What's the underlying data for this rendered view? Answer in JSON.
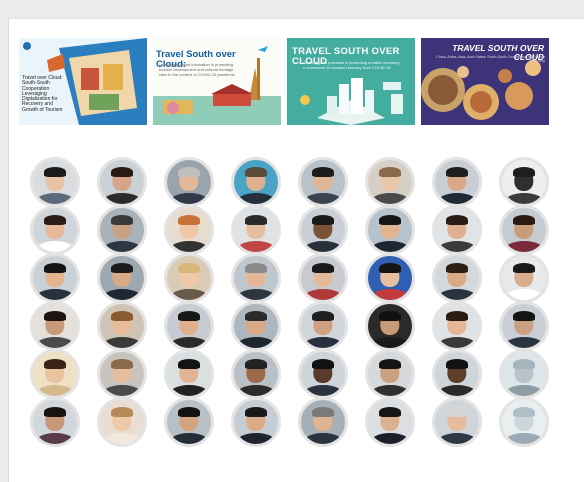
{
  "banners": [
    {
      "id": "banner-1",
      "title": "Travel over Cloud: South-South Cooperation Leveraging Digitalization for Recovery and Growth of Tourism",
      "subtitle": ""
    },
    {
      "id": "banner-2",
      "title": "Travel South over Cloud:",
      "subtitle": "Leveraging digital innovation in promoting tourism development and cultural heritage sites in the context of COVID-19 pandemic"
    },
    {
      "id": "banner-3",
      "title": "TRAVEL SOUTH OVER CLOUD",
      "subtitle": "Sharing good practices in promoting creative economy, e-commerce for tourism recovery from COVID-19"
    },
    {
      "id": "banner-4",
      "title": "TRAVEL SOUTH OVER CLOUD",
      "subtitle": "China–Africa–Asia–Arab States: South-South Cooperation for Tourism Recovery"
    }
  ],
  "participants": [
    {
      "bg": "#d9dde0",
      "skin": "#e8c3a4",
      "hair": "#1b1b1b",
      "suit": "#5b6a7a"
    },
    {
      "bg": "#c9d0d6",
      "skin": "#d4a687",
      "hair": "#2a1a12",
      "suit": "#2b2b2b"
    },
    {
      "bg": "#9aa4ad",
      "skin": "#e4b99a",
      "hair": "#bfbfbf",
      "suit": "#2f3948"
    },
    {
      "bg": "#49a3c7",
      "skin": "#e0b08e",
      "hair": "#5a4a3a",
      "suit": "#26303d"
    },
    {
      "bg": "#b9c2c9",
      "skin": "#e0b596",
      "hair": "#1c1c1c",
      "suit": "#3a4250"
    },
    {
      "bg": "#d6cfc6",
      "skin": "#e9c6a8",
      "hair": "#8a6a4a",
      "suit": "#4a4a4a"
    },
    {
      "bg": "#c8ced3",
      "skin": "#d9a987",
      "hair": "#1f1f1f",
      "suit": "#1f2a36"
    },
    {
      "bg": "#eeeeee",
      "skin": "#2f2f2f",
      "hair": "#1e1e1e",
      "suit": "#3b3b3b"
    },
    {
      "bg": "#cfd5da",
      "skin": "#e6b999",
      "hair": "#2a1d15",
      "suit": "#ffffff"
    },
    {
      "bg": "#aab2b9",
      "skin": "#caa082",
      "hair": "#3a3a3a",
      "suit": "#2d3744"
    },
    {
      "bg": "#e6ddd0",
      "skin": "#f0c7a8",
      "hair": "#c8723a",
      "suit": "#333333"
    },
    {
      "bg": "#dfe3e6",
      "skin": "#e5bd9f",
      "hair": "#2b2b2b",
      "suit": "#c04646"
    },
    {
      "bg": "#c9cfd4",
      "skin": "#7a5238",
      "hair": "#1a1a1a",
      "suit": "#28303b"
    },
    {
      "bg": "#b7c3cc",
      "skin": "#e1b38f",
      "hair": "#161616",
      "suit": "#1f2530"
    },
    {
      "bg": "#e0e4e6",
      "skin": "#ddb092",
      "hair": "#2a1c14",
      "suit": "#3b3b3b"
    },
    {
      "bg": "#c4ccd2",
      "skin": "#c99b78",
      "hair": "#2a1a10",
      "suit": "#7a2a3a"
    },
    {
      "bg": "#c9d1d6",
      "skin": "#e1b48f",
      "hair": "#151515",
      "suit": "#28323f"
    },
    {
      "bg": "#9ea8b0",
      "skin": "#d8ab88",
      "hair": "#1d1d1d",
      "suit": "#1f2733"
    },
    {
      "bg": "#d9cbb5",
      "skin": "#efc9aa",
      "hair": "#d8b87a",
      "suit": "#6a5a4a"
    },
    {
      "bg": "#bfc6cc",
      "skin": "#e2b696",
      "hair": "#8a8a8a",
      "suit": "#2e3642"
    },
    {
      "bg": "#c7cbd0",
      "skin": "#e4b998",
      "hair": "#1a1a1a",
      "suit": "#b03a3a"
    },
    {
      "bg": "#2f5fb3",
      "skin": "#e8bf9e",
      "hair": "#141414",
      "suit": "#c23b3b"
    },
    {
      "bg": "#d3d8dc",
      "skin": "#d9aa86",
      "hair": "#2b1f16",
      "suit": "#2a3340"
    },
    {
      "bg": "#e7e9ea",
      "skin": "#d8ad8c",
      "hair": "#1a1a1a",
      "suit": "#ffffff"
    },
    {
      "bg": "#e4e0da",
      "skin": "#c99a7a",
      "hair": "#1c1410",
      "suit": "#4a4a4a"
    },
    {
      "bg": "#cdc4b6",
      "skin": "#e6bc9a",
      "hair": "#8c5a30",
      "suit": "#3a3a3a"
    },
    {
      "bg": "#c6ccd1",
      "skin": "#e0b08d",
      "hair": "#181818",
      "suit": "#2b2b2b"
    },
    {
      "bg": "#aeb7be",
      "skin": "#d8a887",
      "hair": "#2a2a2a",
      "suit": "#1e2631"
    },
    {
      "bg": "#d0d5d9",
      "skin": "#cfa07f",
      "hair": "#1e1e1e",
      "suit": "#263040"
    },
    {
      "bg": "#2a2a2a",
      "skin": "#c89a78",
      "hair": "#101010",
      "suit": "#1a1a1a"
    },
    {
      "bg": "#dfe3e6",
      "skin": "#e3b796",
      "hair": "#2a1c12",
      "suit": "#3a3a3a"
    },
    {
      "bg": "#c9cfd4",
      "skin": "#caa080",
      "hair": "#151515",
      "suit": "#2b3542"
    },
    {
      "bg": "#efe2c4",
      "skin": "#e9c2a0",
      "hair": "#3a2416",
      "suit": "#d4b98c"
    },
    {
      "bg": "#c8c4bd",
      "skin": "#e6be9e",
      "hair": "#8a6a48",
      "suit": "#4a4a4a"
    },
    {
      "bg": "#dadfe2",
      "skin": "#e1b493",
      "hair": "#141414",
      "suit": "#222222"
    },
    {
      "bg": "#b9c0c6",
      "skin": "#9a6a4a",
      "hair": "#222222",
      "suit": "#2b2b2b"
    },
    {
      "bg": "#cfd4d8",
      "skin": "#5a3a28",
      "hair": "#111111",
      "suit": "#2a3240"
    },
    {
      "bg": "#d6d9dc",
      "skin": "#caa07f",
      "hair": "#151515",
      "suit": "#303030"
    },
    {
      "bg": "#cfd6db",
      "skin": "#5f3e2a",
      "hair": "#121212",
      "suit": "#2a2a2a"
    },
    {
      "bg": "#dfe6ea",
      "skin": "#b8c4cc",
      "hair": "#a9b6bf",
      "suit": "#8e9ca6"
    },
    {
      "bg": "#d2d7db",
      "skin": "#c9977a",
      "hair": "#1a1410",
      "suit": "#5a3a4a"
    },
    {
      "bg": "#e8ded3",
      "skin": "#efc8aa",
      "hair": "#b88a58",
      "suit": "#f2e8dd"
    },
    {
      "bg": "#b8c0c6",
      "skin": "#d3a47f",
      "hair": "#121212",
      "suit": "#252d38"
    },
    {
      "bg": "#c6cdd2",
      "skin": "#d9ab88",
      "hair": "#181818",
      "suit": "#1e2530"
    },
    {
      "bg": "#a7b0b7",
      "skin": "#e0b491",
      "hair": "#7a7a7a",
      "suit": "#2b3340"
    },
    {
      "bg": "#dcdfe1",
      "skin": "#ddb090",
      "hair": "#161616",
      "suit": "#1b1f27"
    },
    {
      "bg": "#d0d5d9",
      "skin": "#e6bc9c",
      "hair": "#d6d6d6",
      "suit": "#2f3846"
    },
    {
      "bg": "#e9eef1",
      "skin": "#cbd6dc",
      "hair": "#b0bec7",
      "suit": "#9aa9b3"
    }
  ]
}
